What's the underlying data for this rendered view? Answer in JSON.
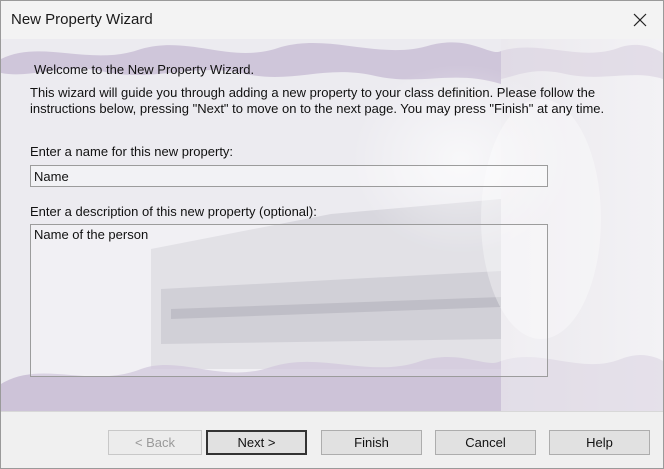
{
  "window": {
    "title": "New Property Wizard"
  },
  "intro": {
    "welcome": "Welcome to the New Property Wizard.",
    "instructions": "This wizard will guide you through adding a new property to your class definition. Please follow the instructions below, pressing \"Next\" to move on to the next page. You may press \"Finish\" at any time."
  },
  "form": {
    "name_label": "Enter a name for this new property:",
    "name_value": "Name",
    "description_label": "Enter a description of this new property (optional):",
    "description_value": "Name of the person"
  },
  "buttons": {
    "back": "< Back",
    "next": "Next >",
    "finish": "Finish",
    "cancel": "Cancel",
    "help": "Help"
  },
  "icons": {
    "close": "close-icon"
  }
}
